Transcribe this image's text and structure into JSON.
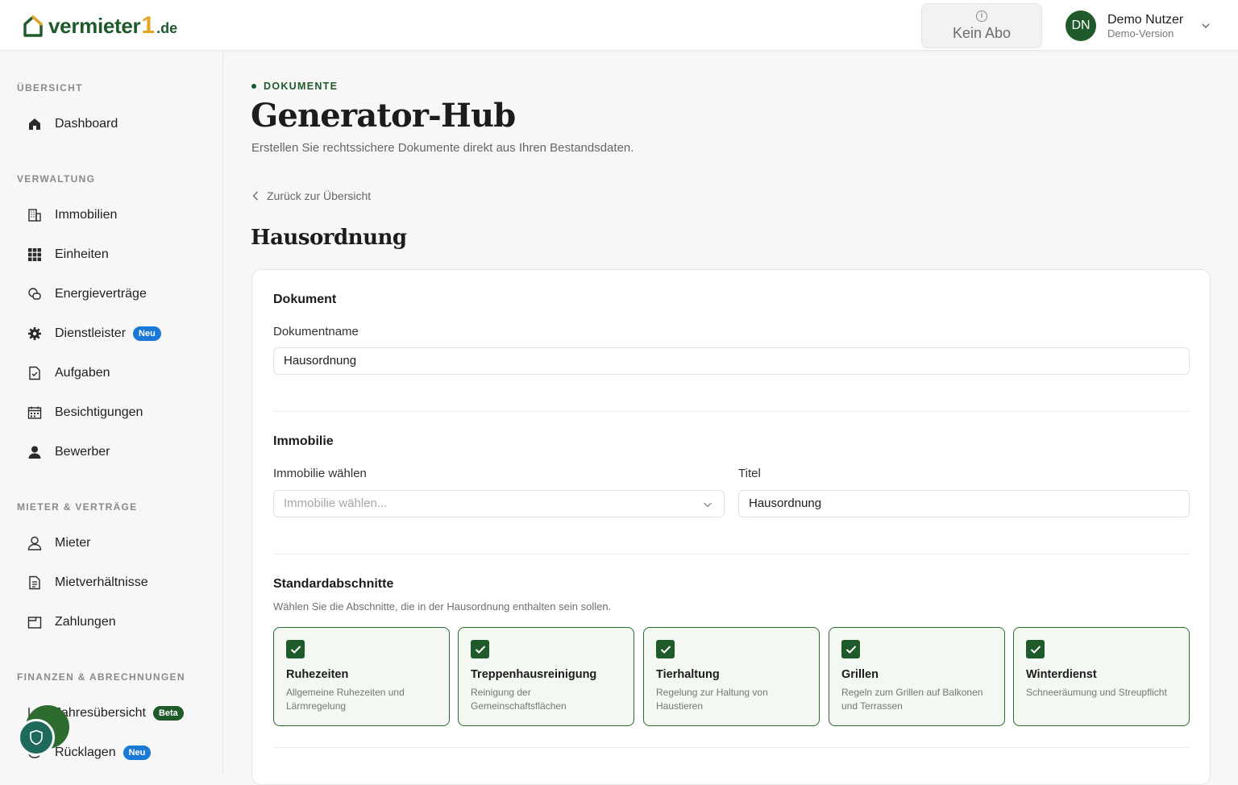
{
  "header": {
    "logo_text": "vermieter",
    "logo_one": "1",
    "logo_tld": ".de",
    "abo_label": "Kein Abo",
    "user_initials": "DN",
    "user_name": "Demo Nutzer",
    "user_sub": "Demo-Version"
  },
  "sidebar": {
    "sections": [
      {
        "label": "ÜBERSICHT"
      },
      {
        "label": "VERWALTUNG"
      },
      {
        "label": "MIETER & VERTRÄGE"
      },
      {
        "label": "FINANZEN & ABRECHNUNGEN"
      }
    ],
    "items": [
      {
        "label": "Dashboard",
        "icon": "home-icon"
      },
      {
        "label": "Immobilien",
        "icon": "building-icon"
      },
      {
        "label": "Einheiten",
        "icon": "grid-icon"
      },
      {
        "label": "Energieverträge",
        "icon": "energy-icon"
      },
      {
        "label": "Dienstleister",
        "icon": "gear-icon",
        "badge": "Neu"
      },
      {
        "label": "Aufgaben",
        "icon": "task-icon"
      },
      {
        "label": "Besichtigungen",
        "icon": "calendar-icon"
      },
      {
        "label": "Bewerber",
        "icon": "person-filled-icon"
      },
      {
        "label": "Mieter",
        "icon": "person-icon"
      },
      {
        "label": "Mietverhältnisse",
        "icon": "document-icon"
      },
      {
        "label": "Zahlungen",
        "icon": "wallet-icon"
      },
      {
        "label": "Jahresübersicht",
        "icon": "chart-icon",
        "badge": "Beta"
      },
      {
        "label": "Rücklagen",
        "icon": "piggy-icon",
        "badge": "Neu"
      }
    ]
  },
  "main": {
    "crumb": "DOKUMENTE",
    "title": "Generator-Hub",
    "subtitle": "Erstellen Sie rechtssichere Dokumente direkt aus Ihren Bestandsdaten.",
    "back_label": "Zurück zur Übersicht",
    "doc_title": "Hausordnung",
    "card": {
      "doc_heading": "Dokument",
      "doc_name_label": "Dokumentname",
      "doc_name_value": "Hausordnung",
      "prop_heading": "Immobilie",
      "prop_label": "Immobilie wählen",
      "prop_placeholder": "Immobilie wählen...",
      "title_label": "Titel",
      "title_value": "Hausordnung",
      "std_heading": "Standardabschnitte",
      "std_help": "Wählen Sie die Abschnitte, die in der Hausordnung enthalten sein sollen.",
      "sections": [
        {
          "title": "Ruhezeiten",
          "desc": "Allgemeine Ruhezeiten und Lärmregelung",
          "checked": true
        },
        {
          "title": "Treppenhausreinigung",
          "desc": "Reinigung der Gemeinschaftsflächen",
          "checked": true
        },
        {
          "title": "Tierhaltung",
          "desc": "Regelung zur Haltung von Haustieren",
          "checked": true
        },
        {
          "title": "Grillen",
          "desc": "Regeln zum Grillen auf Balkonen und Terrassen",
          "checked": true
        },
        {
          "title": "Winterdienst",
          "desc": "Schneeräumung und Streupflicht",
          "checked": true
        }
      ]
    }
  },
  "colors": {
    "brand_green": "#1f5a2b",
    "accent_yellow": "#e3a526",
    "badge_blue": "#1b78d6"
  }
}
